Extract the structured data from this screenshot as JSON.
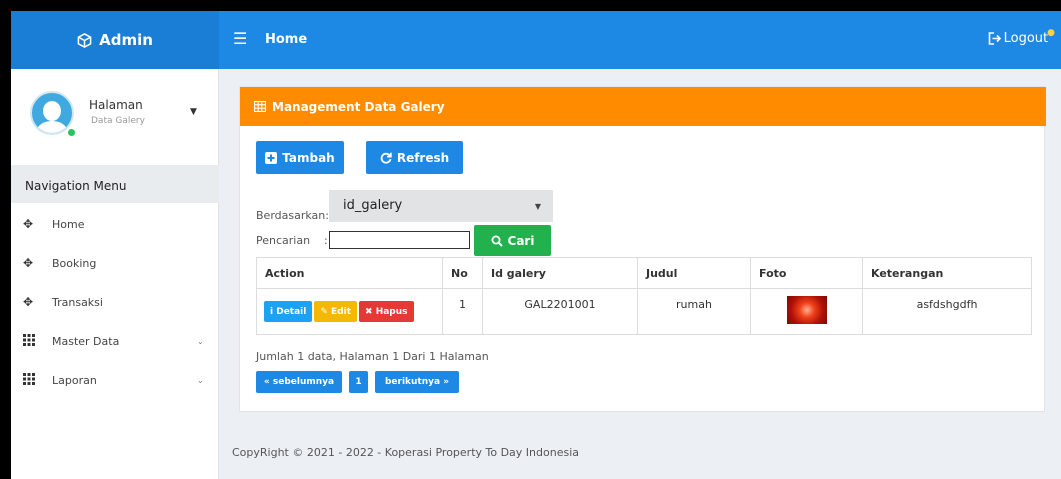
{
  "header": {
    "brand": "Admin",
    "title": "Home",
    "logout_label": "Logout"
  },
  "user": {
    "name": "Halaman",
    "role": "Data Galery"
  },
  "sidebar": {
    "header": "Navigation Menu",
    "items": [
      {
        "label": "Home",
        "icon": "move-icon",
        "has_submenu": false
      },
      {
        "label": "Booking",
        "icon": "move-icon",
        "has_submenu": false
      },
      {
        "label": "Transaksi",
        "icon": "move-icon",
        "has_submenu": false
      },
      {
        "label": "Master Data",
        "icon": "grid-icon",
        "has_submenu": true
      },
      {
        "label": "Laporan",
        "icon": "grid-icon",
        "has_submenu": true
      }
    ]
  },
  "panel": {
    "title": "Management Data Galery",
    "tambah_label": "Tambah",
    "refresh_label": "Refresh",
    "berdasarkan_label": "Berdasarkan:",
    "filter_value": "id_galery",
    "pencarian_label": "Pencarian",
    "colon": ":",
    "search_value": "",
    "cari_label": "Cari"
  },
  "table": {
    "columns": [
      "Action",
      "No",
      "Id galery",
      "Judul",
      "Foto",
      "Keterangan"
    ],
    "action_labels": {
      "detail": "Detail",
      "edit": "Edit",
      "hapus": "Hapus"
    },
    "rows": [
      {
        "no": "1",
        "id": "GAL2201001",
        "judul": "rumah",
        "foto": "red-flower-thumbnail",
        "keterangan": "asfdshgdfh"
      }
    ]
  },
  "pagination": {
    "summary": "Jumlah 1 data, Halaman 1 Dari 1 Halaman",
    "prev": "« sebelumnya",
    "page": "1",
    "next": "berikutnya »"
  },
  "footer": {
    "copyright": "CopyRight © 2021 - 2022 - Koperasi Property To Day Indonesia"
  },
  "colors": {
    "primary": "#1e88e5",
    "panel_header": "#ff8c00",
    "detail": "#1da1f2",
    "edit": "#f5b800",
    "hapus": "#e53935",
    "cari": "#22b14c"
  }
}
